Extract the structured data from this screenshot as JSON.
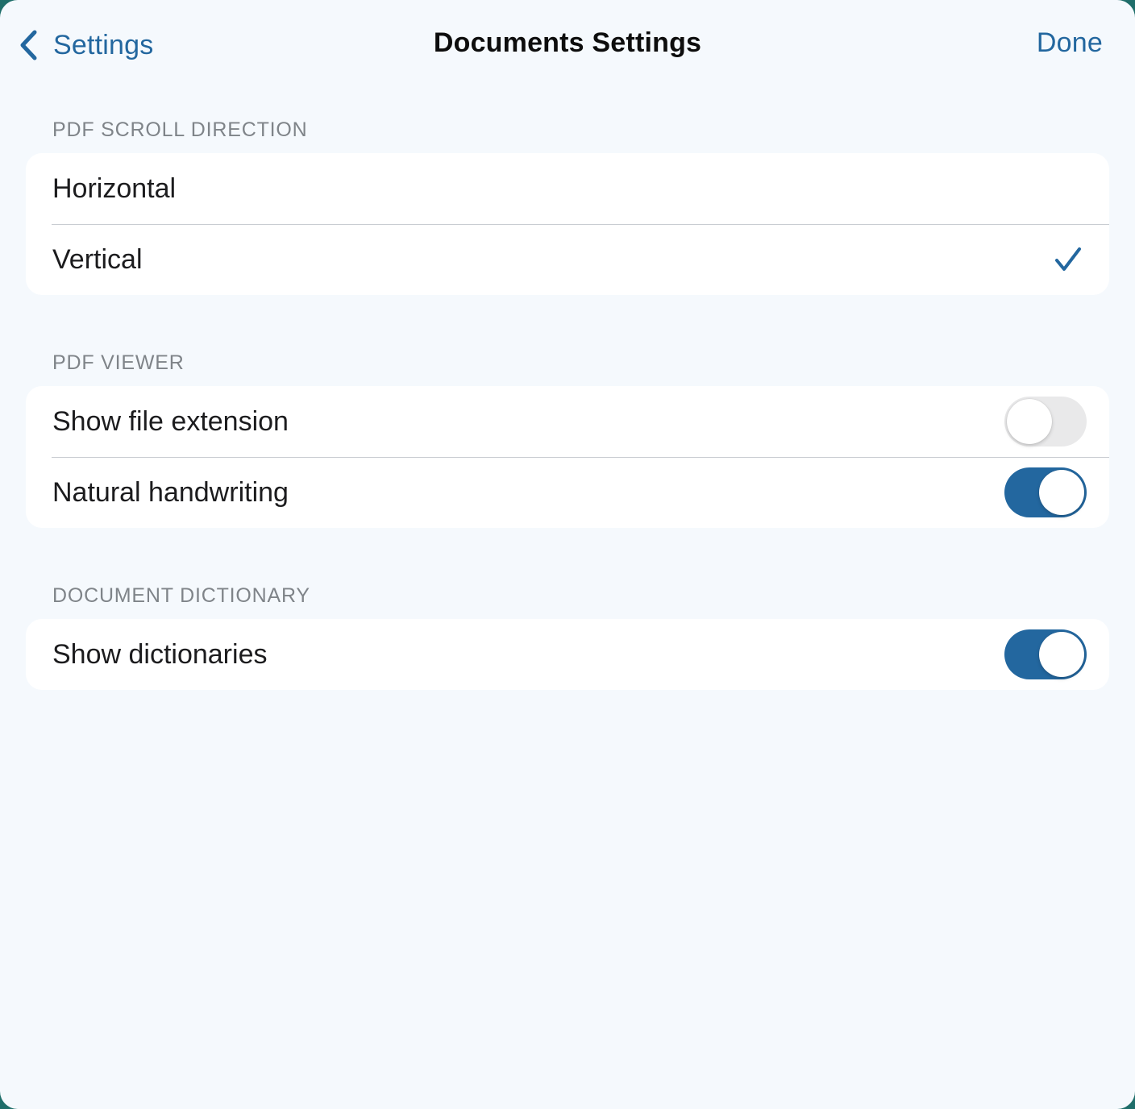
{
  "navbar": {
    "back_label": "Settings",
    "title": "Documents Settings",
    "done_label": "Done"
  },
  "sections": [
    {
      "header": "PDF SCROLL DIRECTION",
      "rows": [
        {
          "label": "Horizontal",
          "selected": false
        },
        {
          "label": "Vertical",
          "selected": true
        }
      ]
    },
    {
      "header": "PDF VIEWER",
      "rows": [
        {
          "label": "Show file extension",
          "toggle": false
        },
        {
          "label": "Natural handwriting",
          "toggle": true
        }
      ]
    },
    {
      "header": "DOCUMENT DICTIONARY",
      "rows": [
        {
          "label": "Show dictionaries",
          "toggle": true
        }
      ]
    }
  ],
  "icons": {
    "back": "chevron-left-icon",
    "selected": "checkmark-icon"
  },
  "colors": {
    "accent": "#23679f",
    "background": "#f5f9fd",
    "card": "#ffffff",
    "section_header": "#7f8489",
    "toggle_off": "#e9e9ea"
  }
}
